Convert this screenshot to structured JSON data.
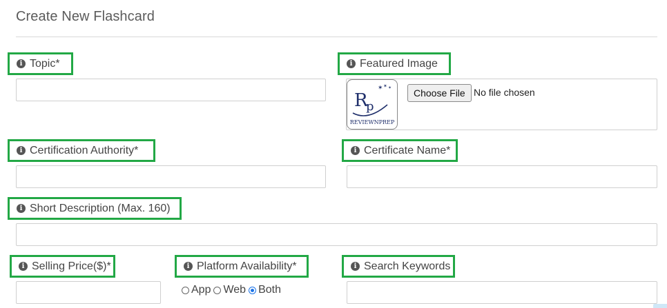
{
  "page": {
    "title": "Create New Flashcard"
  },
  "fields": {
    "topic": {
      "label": "Topic*",
      "value": ""
    },
    "featured_image": {
      "label": "Featured Image",
      "button_label": "Choose File",
      "status": "No file chosen",
      "logo_text": "REVIEWNPREP",
      "logo_monogram": "RP"
    },
    "certification_authority": {
      "label": "Certification Authority*",
      "value": ""
    },
    "certificate_name": {
      "label": "Certificate Name*",
      "value": ""
    },
    "short_description": {
      "label": "Short Description (Max. 160)",
      "value": ""
    },
    "selling_price": {
      "label": "Selling Price($)*",
      "value": ""
    },
    "platform_availability": {
      "label": "Platform Availability*",
      "options": [
        "App",
        "Web",
        "Both"
      ],
      "selected": "Both"
    },
    "search_keywords": {
      "label": "Search Keywords",
      "value": ""
    }
  },
  "icons": {
    "info": "info-circle-icon"
  },
  "colors": {
    "label_border": "#22a845",
    "radio_selected": "#1a73e8"
  }
}
